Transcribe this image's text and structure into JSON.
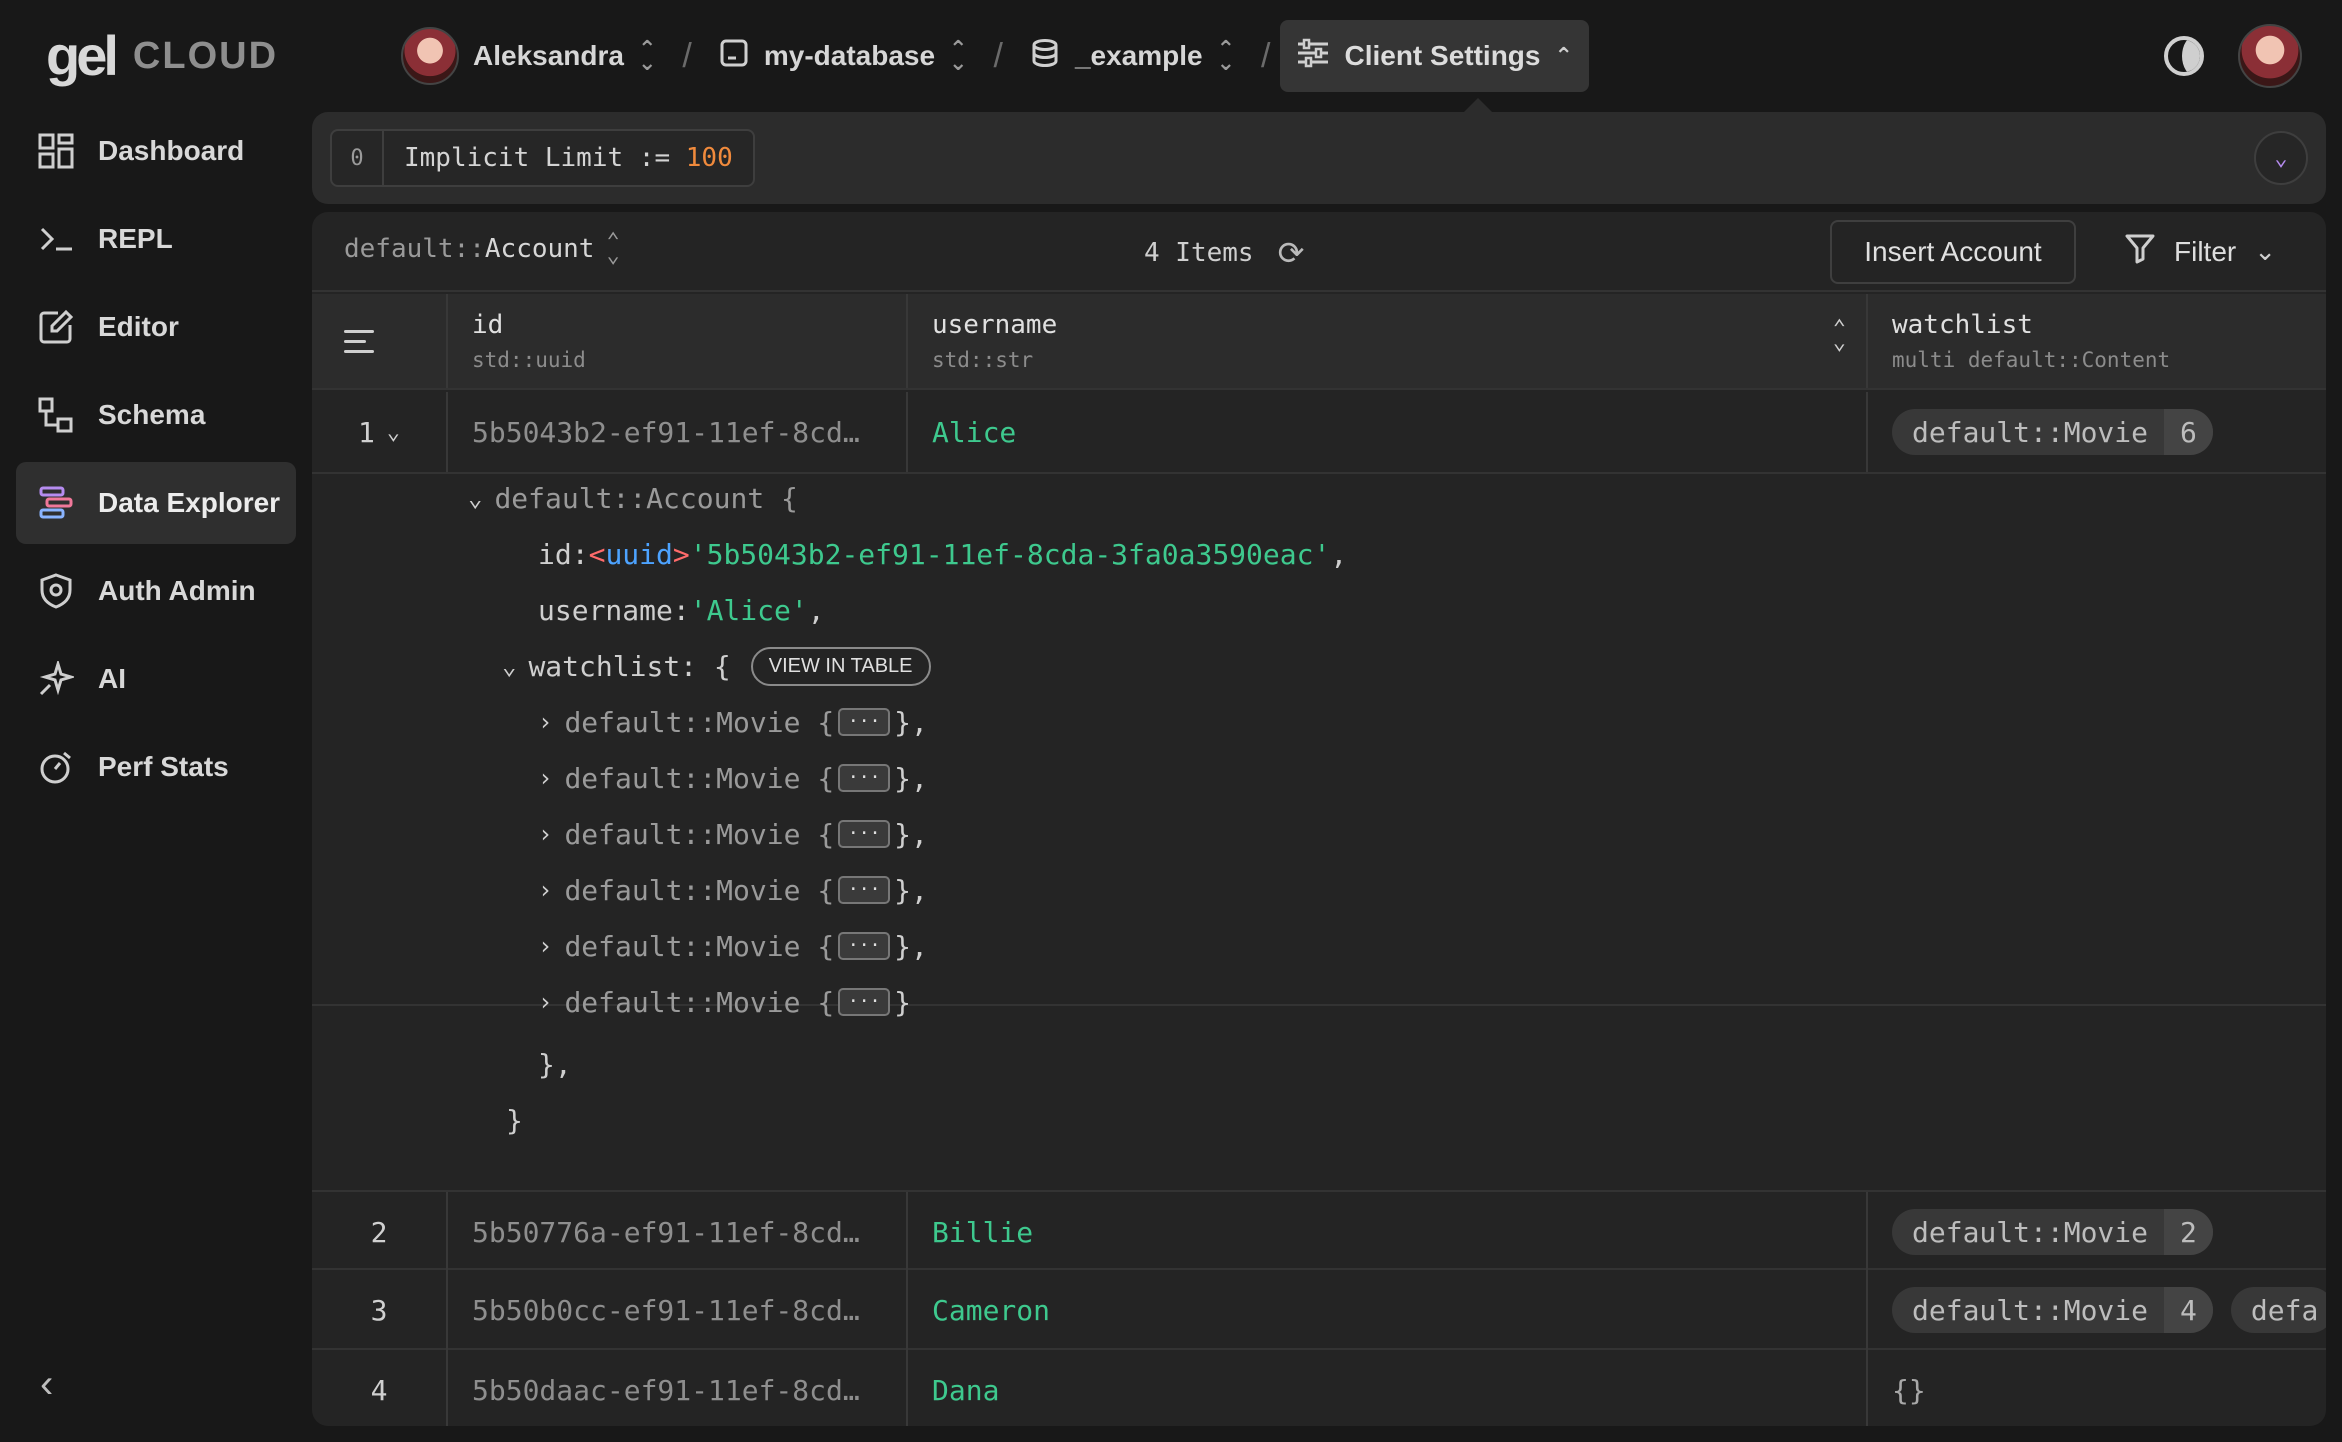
{
  "brand": {
    "logo": "gel",
    "product": "CLOUD"
  },
  "breadcrumbs": [
    {
      "label": "Aleksandra",
      "icon": "user-avatar"
    },
    {
      "label": "my-database",
      "icon": "database-frame-icon"
    },
    {
      "label": "_example",
      "icon": "database-stack-icon"
    },
    {
      "label": "Client Settings",
      "icon": "sliders-icon"
    }
  ],
  "sidebar": {
    "items": [
      {
        "label": "Dashboard",
        "icon": "grid-icon"
      },
      {
        "label": "REPL",
        "icon": "terminal-icon"
      },
      {
        "label": "Editor",
        "icon": "edit-icon"
      },
      {
        "label": "Schema",
        "icon": "schema-icon"
      },
      {
        "label": "Data Explorer",
        "icon": "data-explorer-icon",
        "active": true
      },
      {
        "label": "Auth Admin",
        "icon": "shield-icon"
      },
      {
        "label": "AI",
        "icon": "sparkle-icon"
      },
      {
        "label": "Perf Stats",
        "icon": "stopwatch-icon"
      }
    ],
    "collapse_icon": "chevron-left-icon"
  },
  "limit": {
    "index": "0",
    "text": "Implicit Limit := ",
    "value": "100"
  },
  "toolbar": {
    "object_prefix": "default::",
    "object_name": "Account",
    "count": "4 Items",
    "insert_label": "Insert Account",
    "filter_label": "Filter"
  },
  "columns": [
    {
      "name": "id",
      "type": "std::uuid"
    },
    {
      "name": "username",
      "type": "std::str"
    },
    {
      "name": "watchlist",
      "type": "multi default::Content"
    }
  ],
  "rows": [
    {
      "index": "1",
      "id": "5b5043b2-ef91-11ef-8cd…",
      "username": "Alice",
      "tags": [
        {
          "name": "default::Movie",
          "count": "6"
        }
      ]
    },
    {
      "index": "2",
      "id": "5b50776a-ef91-11ef-8cd…",
      "username": "Billie",
      "tags": [
        {
          "name": "default::Movie",
          "count": "2"
        }
      ]
    },
    {
      "index": "3",
      "id": "5b50b0cc-ef91-11ef-8cd…",
      "username": "Cameron",
      "tags": [
        {
          "name": "default::Movie",
          "count": "4"
        },
        {
          "name": "defa",
          "count": ""
        }
      ]
    },
    {
      "index": "4",
      "id": "5b50daac-ef91-11ef-8cd…",
      "username": "Dana",
      "tags": [],
      "empty": "{}"
    }
  ],
  "detail": {
    "header": "default::Account {",
    "id_key": "id: ",
    "id_cast_open": "<",
    "id_cast_type": "uuid",
    "id_cast_close": ">",
    "id_value": "'5b5043b2-ef91-11ef-8cda-3fa0a3590eac'",
    "username_key": "username: ",
    "username_value": "'Alice'",
    "watchlist_key": "watchlist: {",
    "view_in_table": "VIEW IN TABLE",
    "movie_label": "default::Movie {",
    "dots": "···",
    "close_item": "},",
    "close_last": "}",
    "close_watchlist": "},",
    "close_obj": "}"
  },
  "colors": {
    "accent_green": "#3ec98e",
    "accent_orange": "#f08a3c",
    "accent_purple": "#b68cf0",
    "background": "#181818"
  }
}
